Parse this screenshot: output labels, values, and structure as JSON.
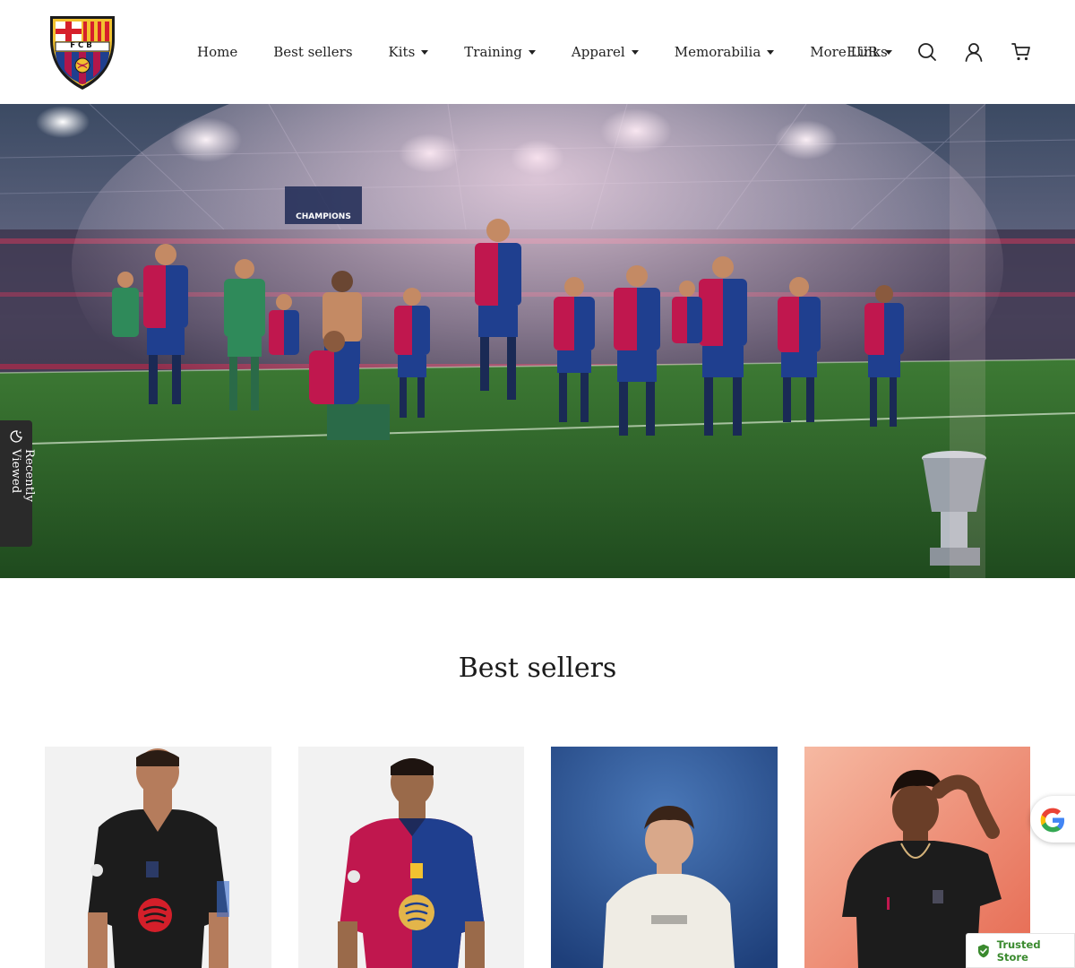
{
  "header": {
    "nav": [
      {
        "label": "Home"
      },
      {
        "label": "Best sellers"
      },
      {
        "label": "Kits",
        "dropdown": true
      },
      {
        "label": "Training",
        "dropdown": true
      },
      {
        "label": "Apparel",
        "dropdown": true
      },
      {
        "label": "Memorabilia",
        "dropdown": true
      },
      {
        "label": "More Links"
      }
    ],
    "currency": "EUR",
    "logo_text": "FCB"
  },
  "hero": {
    "banner_text": "CHAMPIONS"
  },
  "recently_viewed": {
    "label": "Recently Viewed"
  },
  "best_sellers": {
    "title": "Best sellers"
  },
  "badges": {
    "trusted_store": "Trusted Store"
  },
  "colors": {
    "blaugrana_blue": "#1f3f8f",
    "blaugrana_red": "#b2164a",
    "gold": "#f2c230",
    "pitch_green": "#2f6a2a",
    "trusted_green": "#3a8a2e"
  }
}
